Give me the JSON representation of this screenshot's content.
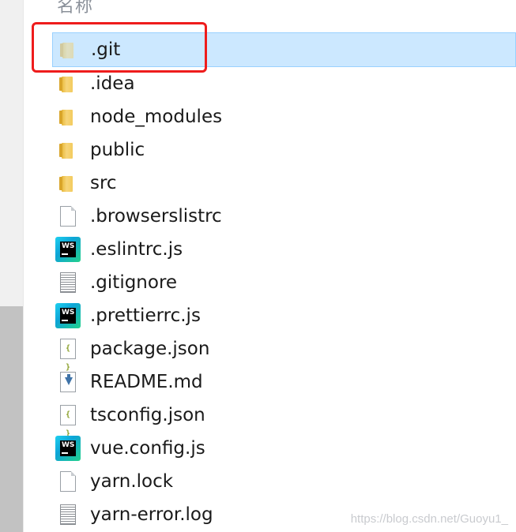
{
  "header": {
    "column_name": "名称"
  },
  "files": [
    {
      "name": ".git",
      "icon": "folder-icon",
      "type": "folder",
      "selected": true,
      "faded": true
    },
    {
      "name": ".idea",
      "icon": "folder-icon",
      "type": "folder"
    },
    {
      "name": "node_modules",
      "icon": "folder-icon",
      "type": "folder"
    },
    {
      "name": "public",
      "icon": "folder-icon",
      "type": "folder"
    },
    {
      "name": "src",
      "icon": "folder-icon",
      "type": "folder"
    },
    {
      "name": ".browserslistrc",
      "icon": "file-icon",
      "type": "file"
    },
    {
      "name": ".eslintrc.js",
      "icon": "webstorm-icon",
      "type": "ws"
    },
    {
      "name": ".gitignore",
      "icon": "text-file-icon",
      "type": "lines"
    },
    {
      "name": ".prettierrc.js",
      "icon": "webstorm-icon",
      "type": "ws"
    },
    {
      "name": "package.json",
      "icon": "json-file-icon",
      "type": "json"
    },
    {
      "name": "README.md",
      "icon": "markdown-file-icon",
      "type": "md"
    },
    {
      "name": "tsconfig.json",
      "icon": "json-file-icon",
      "type": "json"
    },
    {
      "name": "vue.config.js",
      "icon": "webstorm-icon",
      "type": "ws"
    },
    {
      "name": "yarn.lock",
      "icon": "file-icon",
      "type": "file"
    },
    {
      "name": "yarn-error.log",
      "icon": "text-file-icon",
      "type": "lines"
    }
  ],
  "icons": {
    "ws_text": "WS",
    "json_text": "{ }"
  },
  "watermark": "https://blog.csdn.net/Guoyu1_",
  "colors": {
    "selection": "#cce8ff",
    "selection_border": "#99d1ff",
    "highlight": "#ee1c1c"
  }
}
